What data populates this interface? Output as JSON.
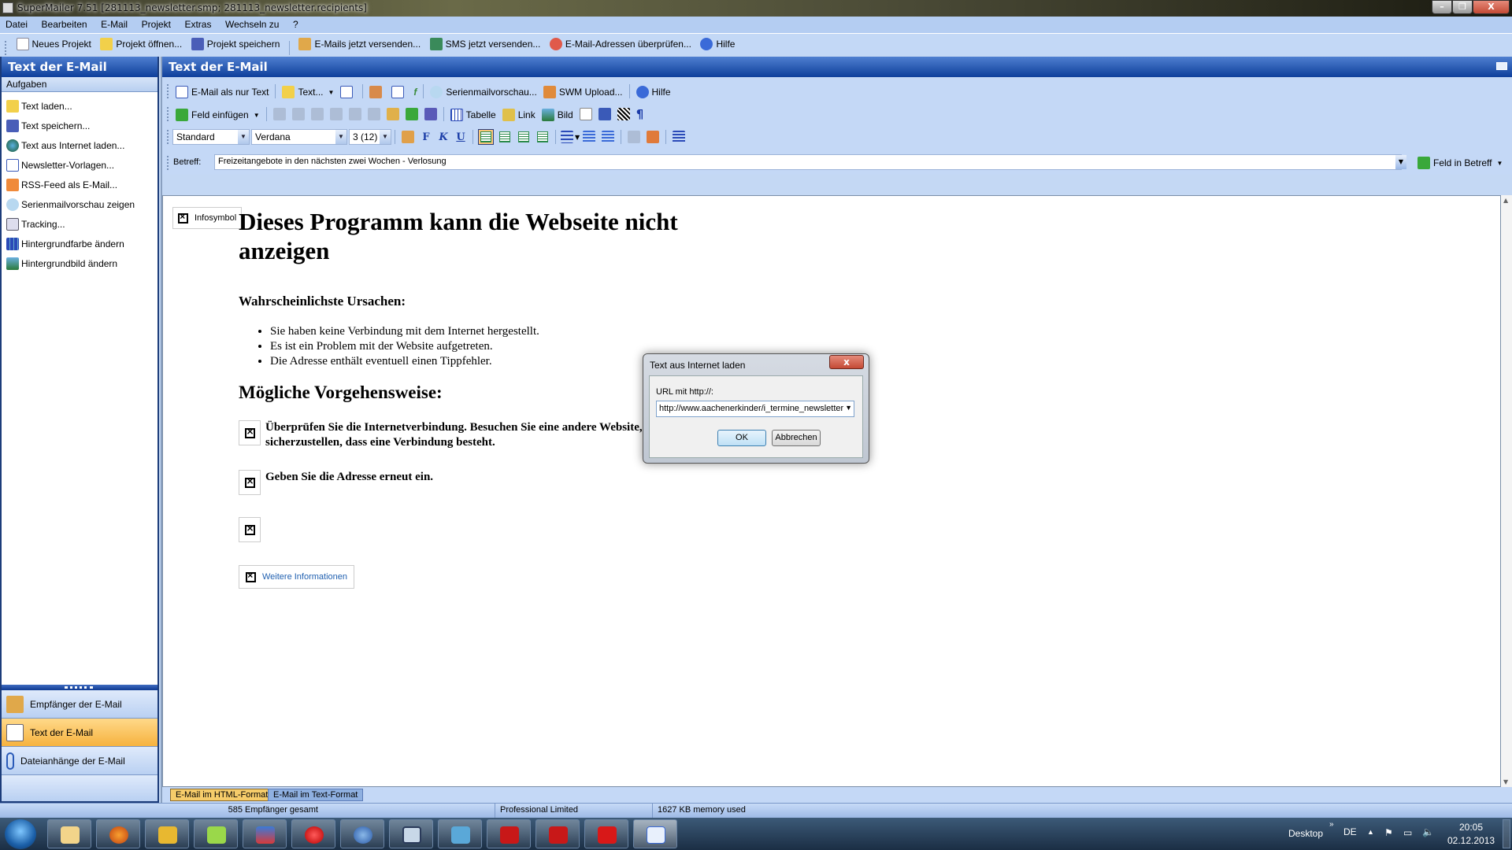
{
  "window": {
    "title": "SuperMailer 7.51 [281113_newsletter.smp; 281113_newsletter.recipients]",
    "controls": {
      "minimize": "–",
      "maximize": "❐",
      "close": "X"
    }
  },
  "menubar": [
    "Datei",
    "Bearbeiten",
    "E-Mail",
    "Projekt",
    "Extras",
    "Wechseln zu",
    "?"
  ],
  "toolbar": {
    "items": [
      {
        "label": "Neues Projekt",
        "icon": "new-document-icon"
      },
      {
        "label": "Projekt öffnen...",
        "icon": "folder-open-icon"
      },
      {
        "label": "Projekt speichern",
        "icon": "floppy-disk-icon"
      },
      {
        "label": "E-Mails jetzt versenden...",
        "icon": "send-mail-icon"
      },
      {
        "label": "SMS jetzt versenden...",
        "icon": "sms-icon"
      },
      {
        "label": "E-Mail-Adressen überprüfen...",
        "icon": "check-address-icon"
      },
      {
        "label": "Hilfe",
        "icon": "help-icon"
      }
    ]
  },
  "leftpanel": {
    "title": "Text der E-Mail",
    "subheader": "Aufgaben",
    "tasks": [
      {
        "label": "Text laden...",
        "icon": "folder-open-icon"
      },
      {
        "label": "Text speichern...",
        "icon": "floppy-disk-icon"
      },
      {
        "label": "Text aus Internet laden...",
        "icon": "globe-icon"
      },
      {
        "label": "Newsletter-Vorlagen...",
        "icon": "template-icon"
      },
      {
        "label": "RSS-Feed als E-Mail...",
        "icon": "rss-icon"
      },
      {
        "label": "Serienmailvorschau zeigen",
        "icon": "preview-magnifier-icon"
      },
      {
        "label": "Tracking...",
        "icon": "tracking-icon"
      },
      {
        "label": "Hintergrundfarbe ändern",
        "icon": "color-grid-icon"
      },
      {
        "label": "Hintergrundbild ändern",
        "icon": "picture-icon"
      }
    ],
    "nav": [
      {
        "label": "Empfänger der E-Mail",
        "icon": "recipients-icon",
        "active": false
      },
      {
        "label": "Text der E-Mail",
        "icon": "email-text-icon",
        "active": true
      },
      {
        "label": "Dateianhänge der E-Mail",
        "icon": "paperclip-icon",
        "active": false
      }
    ]
  },
  "main": {
    "title": "Text der E-Mail",
    "row1": {
      "plain_text": "E-Mail als nur Text",
      "text_menu": "Text...",
      "preview": "Serienmailvorschau...",
      "swm_upload": "SWM Upload...",
      "help": "Hilfe"
    },
    "row2": {
      "insert_field": "Feld einfügen",
      "table": "Tabelle",
      "link": "Link",
      "image": "Bild"
    },
    "row3": {
      "style": "Standard",
      "font": "Verdana",
      "size": "3 (12)",
      "bold": "F",
      "italic": "K",
      "underline": "U"
    },
    "subject": {
      "label": "Betreff:",
      "value": "Freizeitangebote in den nächsten zwei Wochen - Verlosung",
      "field_button": "Feld in Betreff"
    },
    "document": {
      "infosymbol": "Infosymbol",
      "heading": "Dieses Programm kann die Webseite nicht anzeigen",
      "causes_heading": "Wahrscheinlichste Ursachen:",
      "causes": [
        "Sie haben keine Verbindung mit dem Internet hergestellt.",
        "Es ist ein Problem mit der Website aufgetreten.",
        "Die Adresse enthält eventuell einen Tippfehler."
      ],
      "actions_heading": "Mögliche Vorgehensweise:",
      "actions": [
        "Überprüfen Sie die Internetverbindung. Besuchen Sie eine andere Website, um sicherzustellen, dass eine Verbindung besteht.",
        "Geben Sie die Adresse erneut ein.",
        ""
      ],
      "more_info": "Weitere Informationen"
    },
    "tabs": [
      "E-Mail im HTML-Format",
      "E-Mail im Text-Format"
    ]
  },
  "dialog": {
    "title": "Text aus Internet laden",
    "label": "URL mit http://:",
    "url": "http://www.aachenerkinder/i_termine_newsletter",
    "ok": "OK",
    "cancel": "Abbrechen"
  },
  "statusbar": {
    "recipients": "585 Empfänger gesamt",
    "edition": "Professional Limited",
    "memory": "1627 KB memory used"
  },
  "taskbar": {
    "apps": [
      "explorer",
      "firefox",
      "security",
      "notepad-plus",
      "sync",
      "opera",
      "thunderbird",
      "virtualbox",
      "inkscape",
      "filezilla",
      "acrobat",
      "avira",
      "supermailer"
    ],
    "desktop": "Desktop",
    "lang": "DE",
    "time": "20:05",
    "date": "02.12.2013"
  }
}
